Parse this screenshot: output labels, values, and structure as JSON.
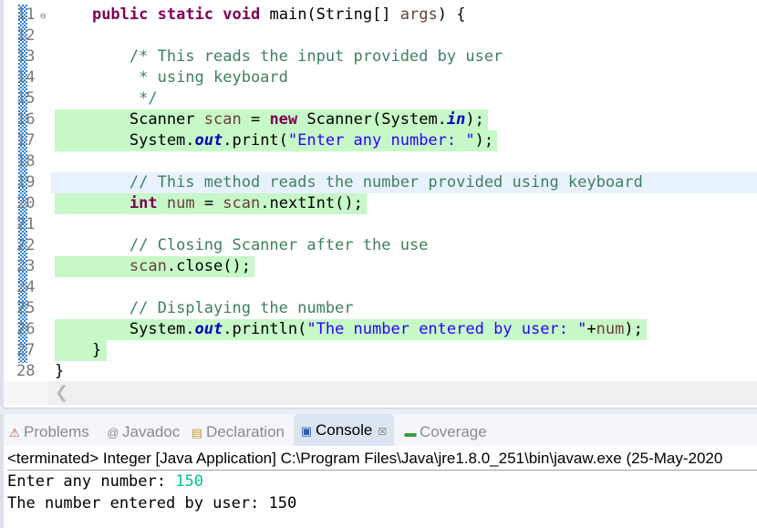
{
  "editor": {
    "lines": [
      {
        "n": "11",
        "fold": true,
        "hl": "",
        "tokens": [
          [
            "",
            "    "
          ],
          [
            "kw",
            "public"
          ],
          [
            "",
            " "
          ],
          [
            "kw",
            "static"
          ],
          [
            "",
            " "
          ],
          [
            "kw",
            "void"
          ],
          [
            "",
            " main(String[] "
          ],
          [
            "var",
            "args"
          ],
          [
            "",
            " ) {"
          ]
        ]
      },
      {
        "n": "12",
        "hl": "",
        "tokens": []
      },
      {
        "n": "13",
        "hl": "",
        "tokens": [
          [
            "",
            "        "
          ],
          [
            "cm",
            "/* This reads the input provided by user"
          ]
        ]
      },
      {
        "n": "14",
        "hl": "",
        "tokens": [
          [
            "",
            "        "
          ],
          [
            "cm",
            " * using keyboard"
          ]
        ]
      },
      {
        "n": "15",
        "hl": "",
        "tokens": [
          [
            "",
            "        "
          ],
          [
            "cm",
            " */"
          ]
        ]
      },
      {
        "n": "16",
        "hl": "hl",
        "tokens": [
          [
            "",
            "        Scanner "
          ],
          [
            "var",
            "scan"
          ],
          [
            "",
            " = "
          ],
          [
            "kw",
            "new"
          ],
          [
            "",
            " Scanner(System."
          ],
          [
            "fld",
            "in"
          ],
          [
            "",
            ");"
          ]
        ]
      },
      {
        "n": "17",
        "hl": "hl",
        "tokens": [
          [
            "",
            "        System."
          ],
          [
            "fld",
            "out"
          ],
          [
            "",
            ".print("
          ],
          [
            "str",
            "\"Enter any number: \""
          ],
          [
            "",
            ");"
          ]
        ]
      },
      {
        "n": "18",
        "hl": "",
        "tokens": []
      },
      {
        "n": "19",
        "hl": "cur",
        "tokens": [
          [
            "",
            "        "
          ],
          [
            "cm",
            "// This method reads the number provided using keyboard"
          ]
        ]
      },
      {
        "n": "20",
        "hl": "hl",
        "tokens": [
          [
            "",
            "        "
          ],
          [
            "kw",
            "int"
          ],
          [
            "",
            " "
          ],
          [
            "var",
            "num"
          ],
          [
            "",
            " = "
          ],
          [
            "var",
            "scan"
          ],
          [
            "",
            ".nextInt();"
          ]
        ]
      },
      {
        "n": "21",
        "hl": "",
        "tokens": []
      },
      {
        "n": "22",
        "hl": "",
        "tokens": [
          [
            "",
            "        "
          ],
          [
            "cm",
            "// Closing Scanner after the use"
          ]
        ]
      },
      {
        "n": "23",
        "hl": "hl",
        "tokens": [
          [
            "",
            "        "
          ],
          [
            "var",
            "scan"
          ],
          [
            "",
            ".close();"
          ]
        ]
      },
      {
        "n": "24",
        "hl": "",
        "tokens": []
      },
      {
        "n": "25",
        "hl": "",
        "tokens": [
          [
            "",
            "        "
          ],
          [
            "cm",
            "// Displaying the number"
          ]
        ]
      },
      {
        "n": "26",
        "hl": "hl",
        "tokens": [
          [
            "",
            "        System."
          ],
          [
            "fld",
            "out"
          ],
          [
            "",
            ".println("
          ],
          [
            "str",
            "\"The number entered by user: \""
          ],
          [
            "",
            "+"
          ],
          [
            "var",
            "num"
          ],
          [
            "",
            ");"
          ]
        ]
      },
      {
        "n": "27",
        "hl": "hl27",
        "tokens": [
          [
            "",
            "    }"
          ]
        ]
      },
      {
        "n": "28",
        "hl": "",
        "tokens": [
          [
            "",
            "}"
          ]
        ]
      }
    ],
    "scroll_left_icon": "chevron-left-icon"
  },
  "panel": {
    "tabs": [
      {
        "id": "problems",
        "label": "Problems",
        "icon": "problems-icon",
        "glyph": "⚠",
        "active": false
      },
      {
        "id": "javadoc",
        "label": "Javadoc",
        "icon": "javadoc-icon",
        "glyph": "@",
        "active": false
      },
      {
        "id": "declaration",
        "label": "Declaration",
        "icon": "declaration-icon",
        "glyph": "▤",
        "active": false
      },
      {
        "id": "console",
        "label": "Console",
        "icon": "console-icon",
        "glyph": "▣",
        "active": true,
        "close": "☒"
      },
      {
        "id": "coverage",
        "label": "Coverage",
        "icon": "coverage-icon",
        "glyph": "▬",
        "active": false
      }
    ],
    "status": "<terminated> Integer [Java Application] C:\\Program Files\\Java\\jre1.8.0_251\\bin\\javaw.exe  (25-May-2020",
    "console": {
      "prompt": "Enter any number: ",
      "input": "150",
      "output": "The number entered by user: 150"
    }
  }
}
